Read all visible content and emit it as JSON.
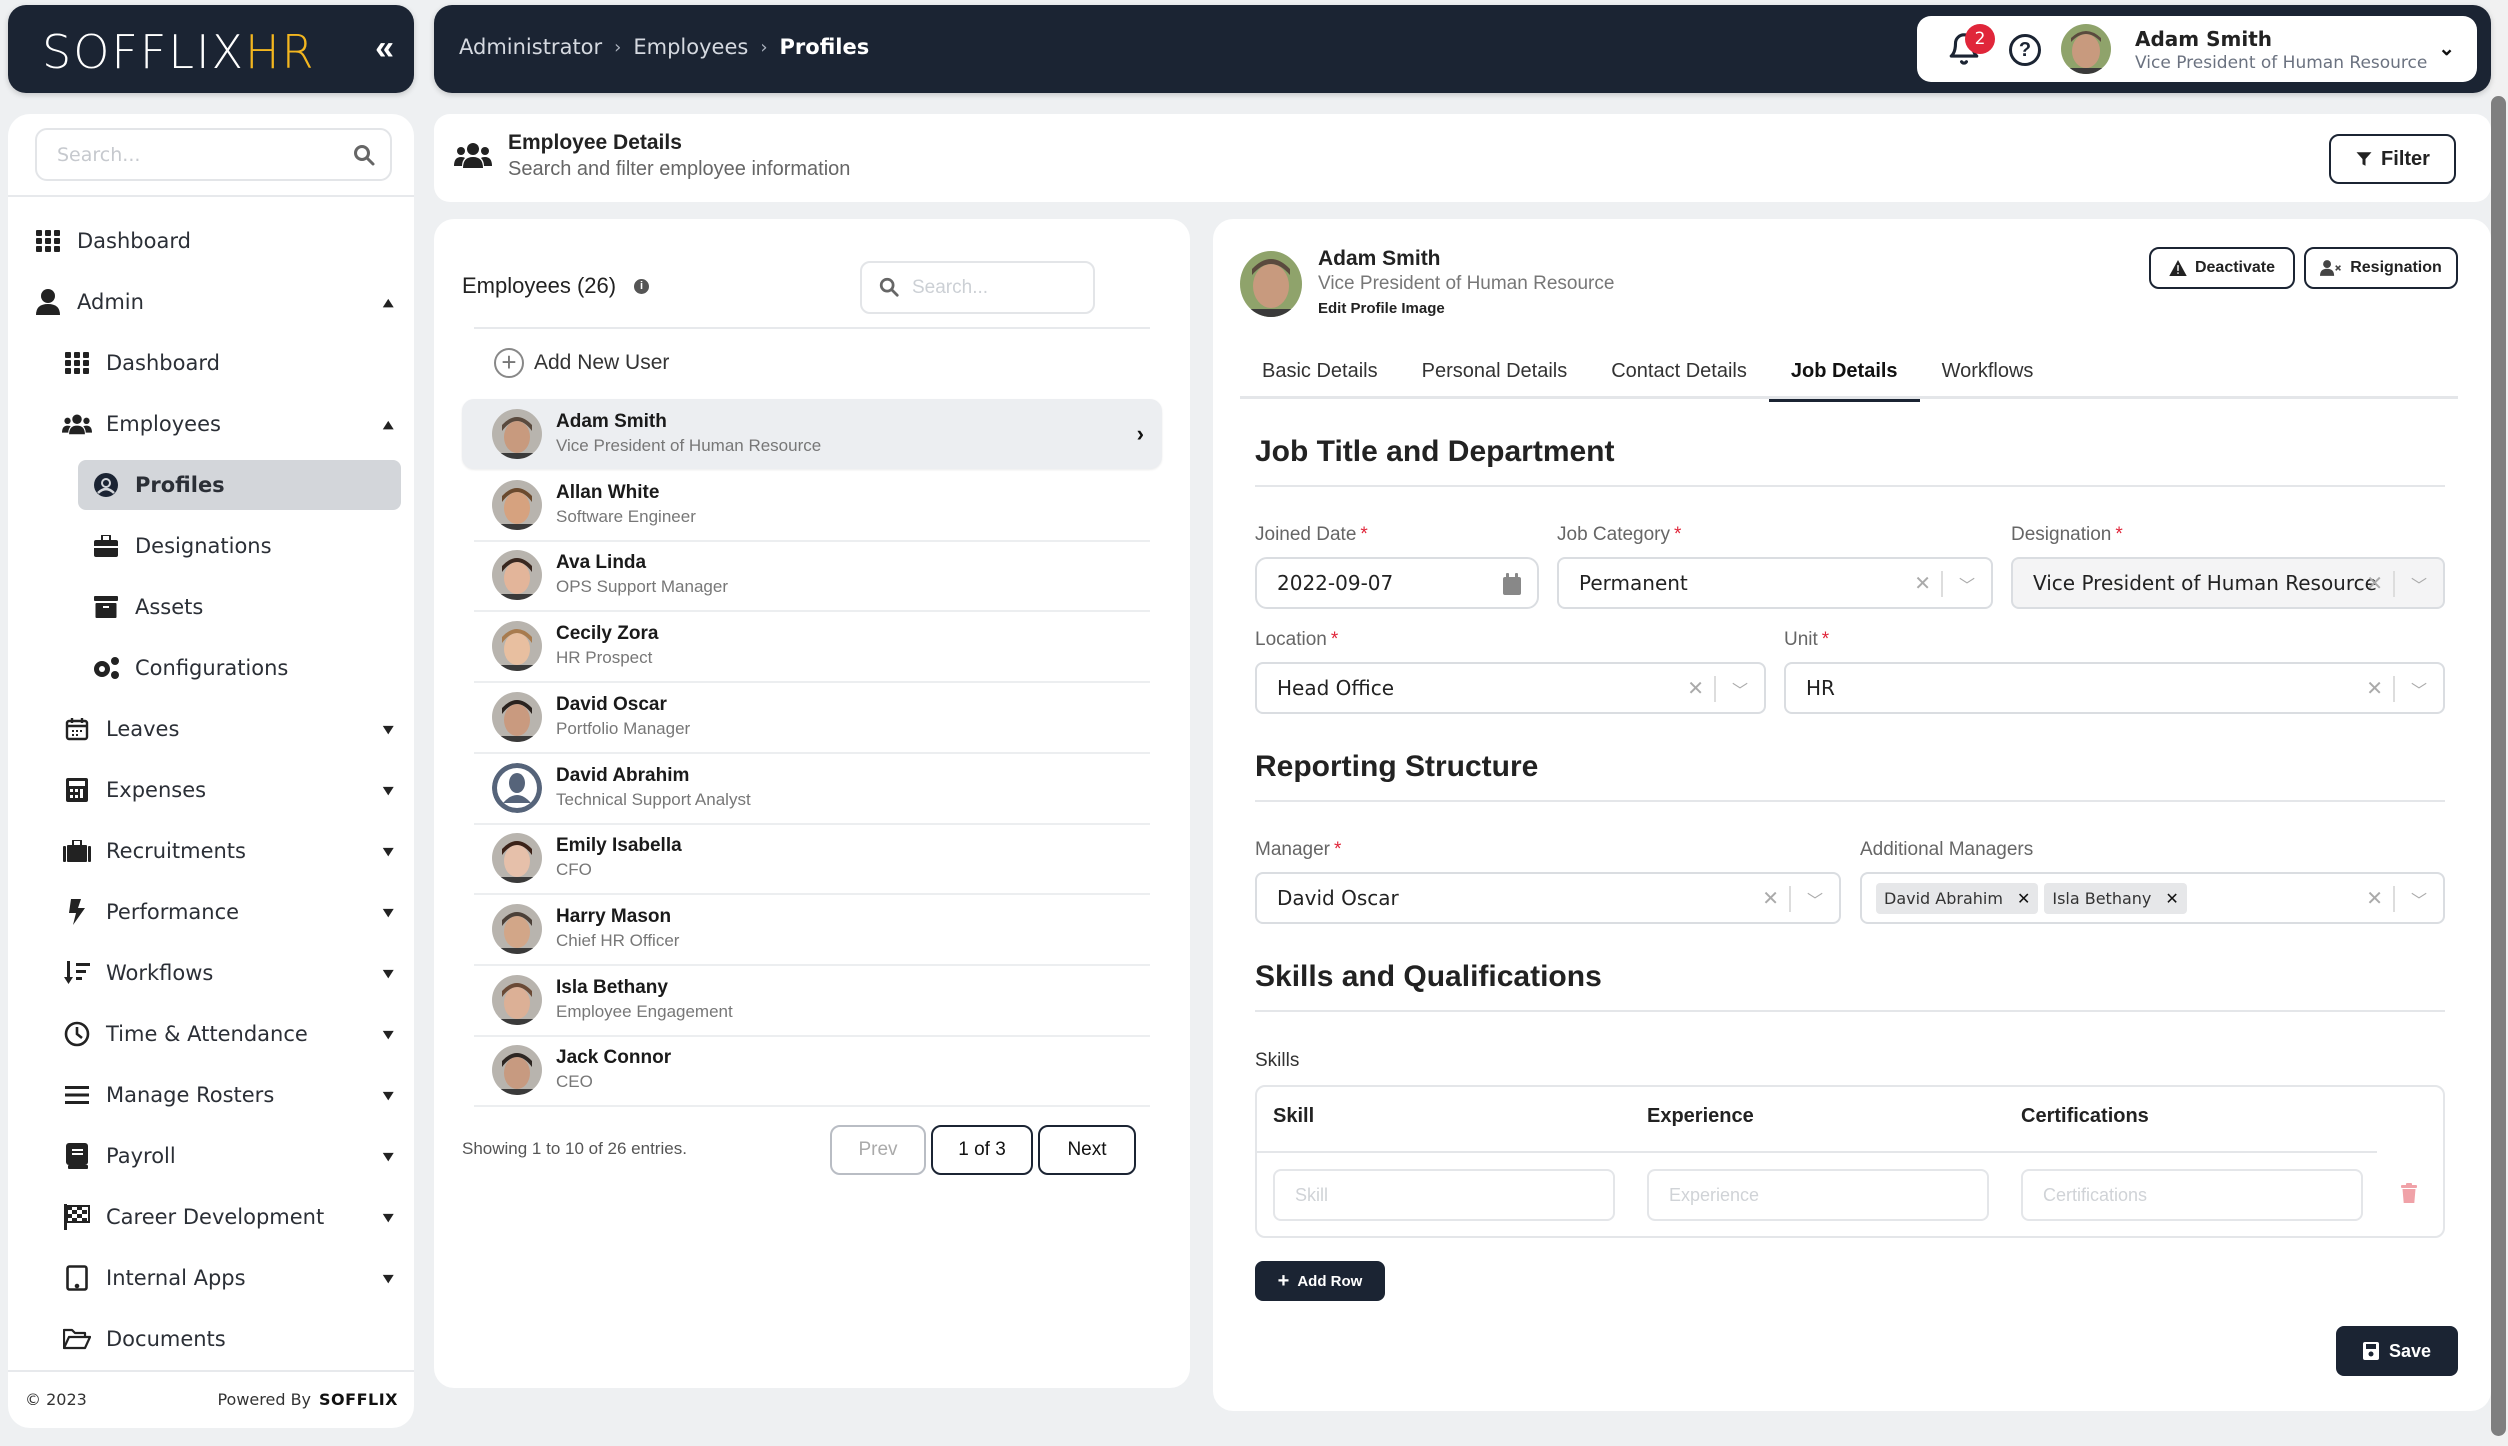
{
  "app": {
    "logo_main": "SOFFLIX",
    "logo_accent": "HR",
    "collapse_icon": "double-chevron-left-icon"
  },
  "breadcrumb": [
    "Administrator",
    "Employees",
    "Profiles"
  ],
  "user": {
    "name": "Adam Smith",
    "role": "Vice President of Human Resource",
    "notifications": "2"
  },
  "sidebar": {
    "search_placeholder": "Search...",
    "items": [
      {
        "label": "Dashboard",
        "icon": "grid-icon",
        "level": 0
      },
      {
        "label": "Admin",
        "icon": "user-icon",
        "level": 0,
        "expanded": true
      },
      {
        "label": "Dashboard",
        "icon": "grid-icon",
        "level": 1
      },
      {
        "label": "Employees",
        "icon": "users-icon",
        "level": 1,
        "expanded": true
      },
      {
        "label": "Profiles",
        "icon": "user-circle-icon",
        "level": 2,
        "active": true
      },
      {
        "label": "Designations",
        "icon": "briefcase-icon",
        "level": 2
      },
      {
        "label": "Assets",
        "icon": "archive-icon",
        "level": 2
      },
      {
        "label": "Configurations",
        "icon": "gears-icon",
        "level": 2
      },
      {
        "label": "Leaves",
        "icon": "calendar-icon",
        "level": 1,
        "expanded": false
      },
      {
        "label": "Expenses",
        "icon": "calculator-icon",
        "level": 1,
        "expanded": false
      },
      {
        "label": "Recruitments",
        "icon": "suitcase-icon",
        "level": 1,
        "expanded": false
      },
      {
        "label": "Performance",
        "icon": "bolt-icon",
        "level": 1,
        "expanded": false
      },
      {
        "label": "Workflows",
        "icon": "sort-icon",
        "level": 1,
        "expanded": false
      },
      {
        "label": "Time & Attendance",
        "icon": "clock-icon",
        "level": 1,
        "expanded": false
      },
      {
        "label": "Manage Rosters",
        "icon": "bars-icon",
        "level": 1,
        "expanded": false
      },
      {
        "label": "Payroll",
        "icon": "book-icon",
        "level": 1,
        "expanded": false
      },
      {
        "label": "Career Development",
        "icon": "flag-checkered-icon",
        "level": 1,
        "expanded": false
      },
      {
        "label": "Internal Apps",
        "icon": "tablet-icon",
        "level": 1,
        "expanded": false
      },
      {
        "label": "Documents",
        "icon": "folder-open-icon",
        "level": 1
      }
    ],
    "copyright": "© 2023",
    "powered_by": "Powered By",
    "powered_brand": "SOFFLIX"
  },
  "header": {
    "title": "Employee Details",
    "subtitle": "Search and filter employee information",
    "filter_label": "Filter"
  },
  "employees": {
    "title": "Employees (26)",
    "search_placeholder": "Search...",
    "add_label": "Add New User",
    "list": [
      {
        "name": "Adam Smith",
        "role": "Vice President of Human Resource",
        "selected": true,
        "skin": "#c89a7e",
        "hair": "#5a4a3e"
      },
      {
        "name": "Allan White",
        "role": "Software Engineer",
        "skin": "#d6a27f",
        "hair": "#6b4a2e"
      },
      {
        "name": "Ava Linda",
        "role": "OPS Support Manager",
        "skin": "#e3b59a",
        "hair": "#3a2820"
      },
      {
        "name": "Cecily Zora",
        "role": "HR Prospect",
        "skin": "#e8bfa0",
        "hair": "#a87b4e"
      },
      {
        "name": "David Oscar",
        "role": "Portfolio Manager",
        "skin": "#c99a7f",
        "hair": "#2a221e"
      },
      {
        "name": "David Abrahim",
        "role": "Technical Support Analyst",
        "placeholder": true
      },
      {
        "name": "Emily Isabella",
        "role": "CFO",
        "skin": "#e6c0aa",
        "hair": "#3b2218"
      },
      {
        "name": "Harry Mason",
        "role": "Chief HR Officer",
        "skin": "#d2a688",
        "hair": "#4b4038"
      },
      {
        "name": "Isla Bethany",
        "role": "Employee Engagement",
        "skin": "#dcb096",
        "hair": "#6a4a36"
      },
      {
        "name": "Jack Connor",
        "role": "CEO",
        "skin": "#c79a80",
        "hair": "#2d2622"
      }
    ],
    "showing": "Showing 1 to 10 of 26 entries.",
    "prev_label": "Prev",
    "page_indicator": "1 of 3",
    "next_label": "Next"
  },
  "detail": {
    "name": "Adam Smith",
    "role": "Vice President of Human Resource",
    "edit_image": "Edit Profile Image",
    "deactivate_label": "Deactivate",
    "resignation_label": "Resignation",
    "tabs": [
      "Basic Details",
      "Personal Details",
      "Contact Details",
      "Job Details",
      "Workflows"
    ],
    "active_tab": "Job Details",
    "job_section": {
      "title": "Job Title and Department",
      "joined_date": {
        "label": "Joined Date",
        "value": "2022-09-07"
      },
      "job_category": {
        "label": "Job Category",
        "value": "Permanent"
      },
      "designation": {
        "label": "Designation",
        "value": "Vice President of Human Resource"
      },
      "location": {
        "label": "Location",
        "value": "Head Office"
      },
      "unit": {
        "label": "Unit",
        "value": "HR"
      }
    },
    "reporting_section": {
      "title": "Reporting Structure",
      "manager": {
        "label": "Manager",
        "value": "David Oscar"
      },
      "additional_managers": {
        "label": "Additional Managers",
        "values": [
          "David Abrahim",
          "Isla Bethany"
        ]
      }
    },
    "skills_section": {
      "title": "Skills and Qualifications",
      "skills_label": "Skills",
      "columns": [
        "Skill",
        "Experience",
        "Certifications"
      ],
      "placeholders": [
        "Skill",
        "Experience",
        "Certifications"
      ],
      "add_row_label": "Add Row"
    },
    "save_label": "Save"
  },
  "colors": {
    "navy": "#1b2433",
    "accent_yellow": "#f3b61f",
    "badge_red": "#e0263a",
    "required_red": "#e0263a",
    "delete_pink": "#f0a2a8"
  }
}
